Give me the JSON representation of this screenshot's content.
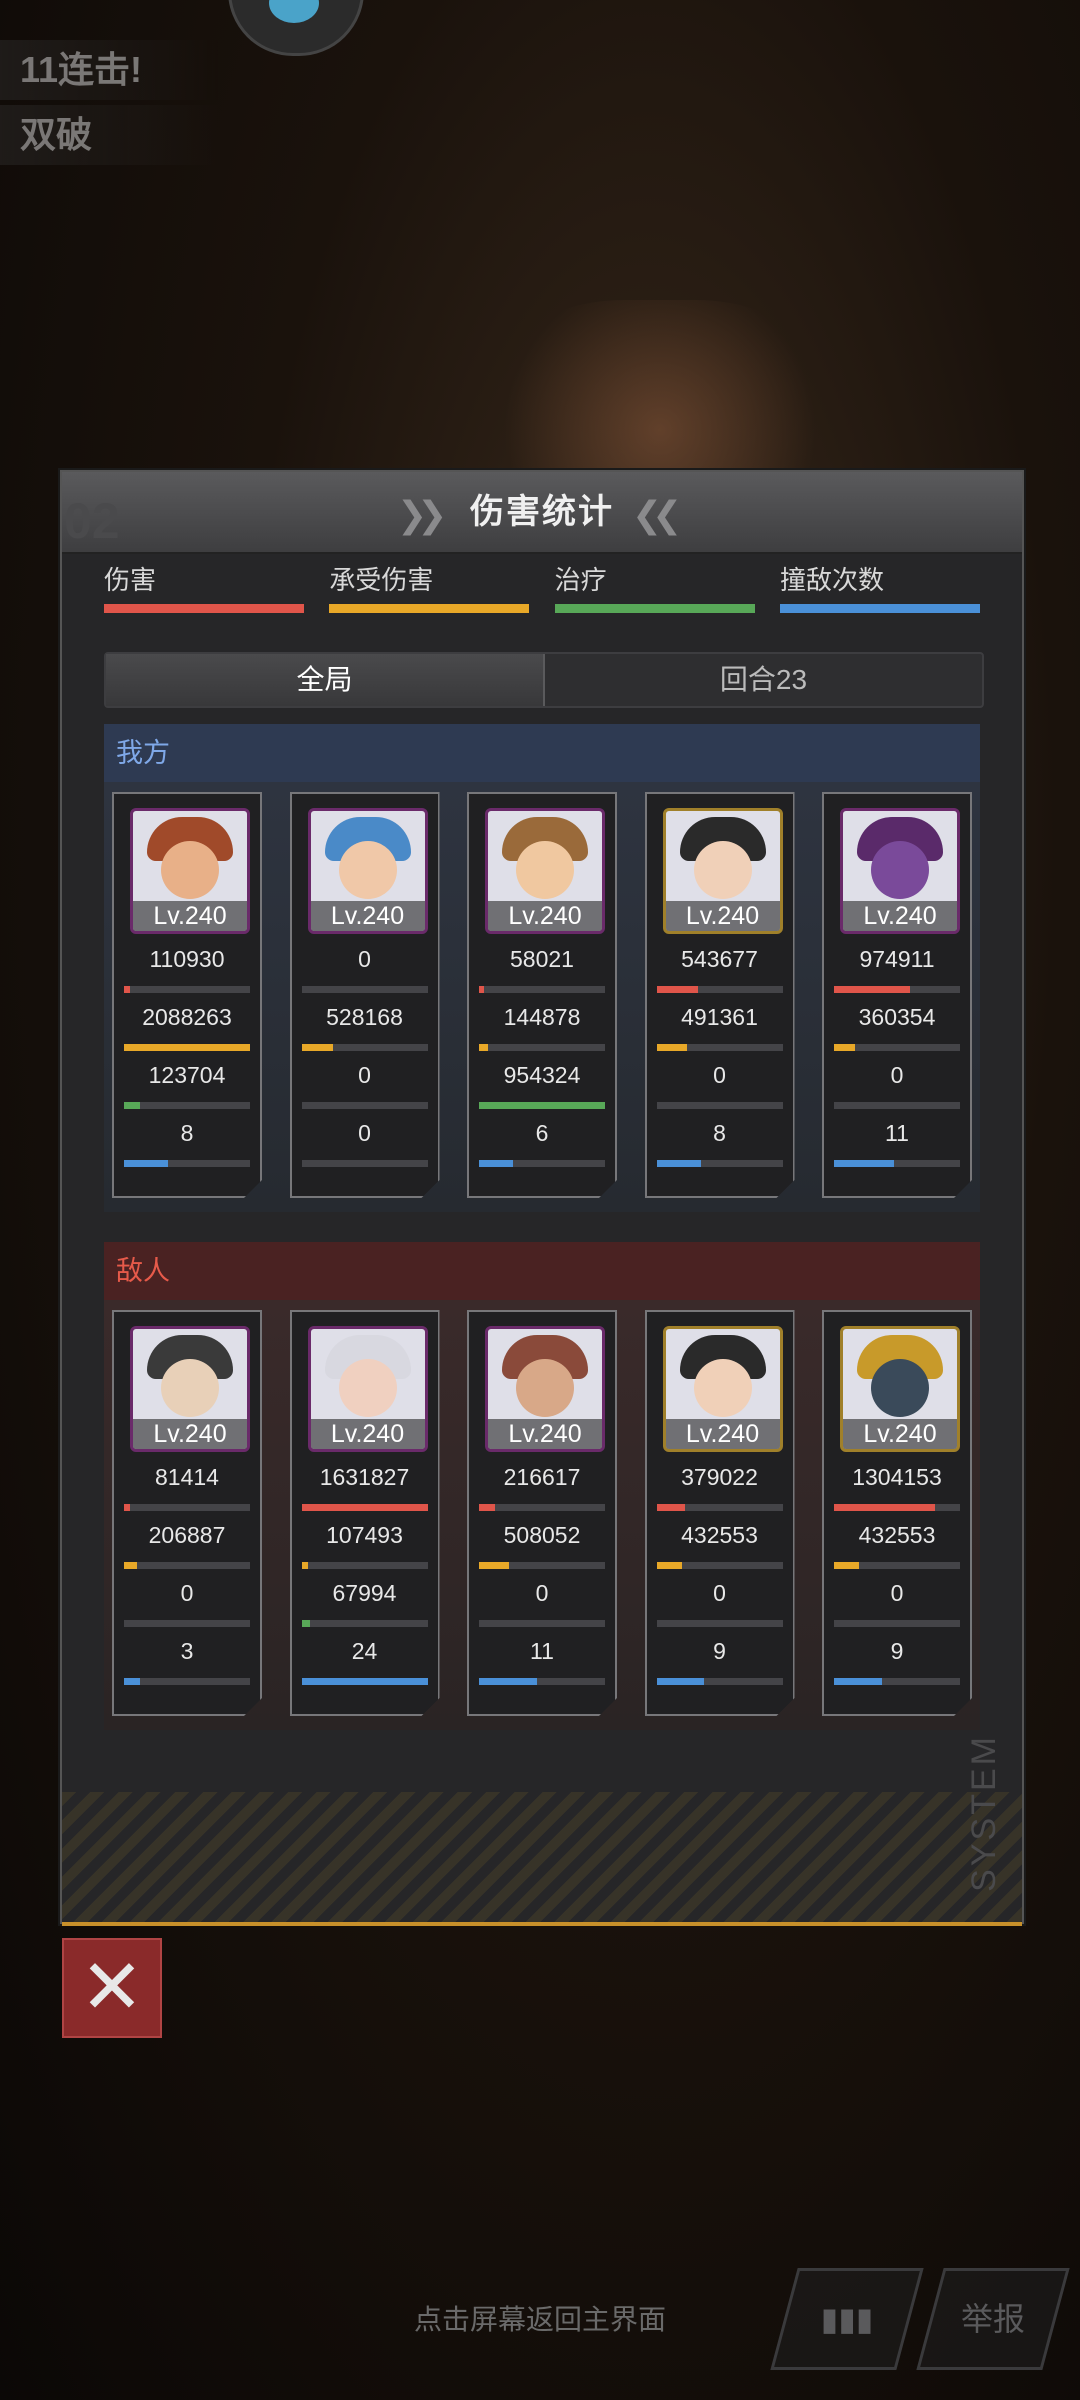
{
  "combo": {
    "line1": "11连击!",
    "line2": "双破"
  },
  "panel": {
    "title": "伤害统计",
    "chevrons_left": "❯❯",
    "chevrons_right": "❮❮",
    "side_deco": "02"
  },
  "legend": [
    {
      "label": "伤害",
      "color": "#e0554a"
    },
    {
      "label": "承受伤害",
      "color": "#e8a828"
    },
    {
      "label": "治疗",
      "color": "#58a858"
    },
    {
      "label": "撞敌次数",
      "color": "#4a90d8"
    }
  ],
  "tabs": [
    {
      "label": "全局",
      "active": true
    },
    {
      "label": "回合23",
      "active": false
    }
  ],
  "ours": {
    "title": "我方",
    "units": [
      {
        "level": "Lv.240",
        "frame": "purple",
        "hair": "#a04a2a",
        "face": "#e8b088",
        "damage": "110930",
        "taken": "2088263",
        "heal": "123704",
        "hits": "8",
        "bars": [
          0.05,
          1.0,
          0.13,
          0.35
        ]
      },
      {
        "level": "Lv.240",
        "frame": "purple",
        "hair": "#4a8ac8",
        "face": "#f0c8a8",
        "damage": "0",
        "taken": "528168",
        "heal": "0",
        "hits": "0",
        "bars": [
          0,
          0.25,
          0,
          0
        ]
      },
      {
        "level": "Lv.240",
        "frame": "purple",
        "hair": "#9a6a3a",
        "face": "#f0c8a0",
        "damage": "58021",
        "taken": "144878",
        "heal": "954324",
        "hits": "6",
        "bars": [
          0.04,
          0.07,
          1.0,
          0.27
        ]
      },
      {
        "level": "Lv.240",
        "frame": "gold",
        "hair": "#2a2a2a",
        "face": "#f0d0b8",
        "damage": "543677",
        "taken": "491361",
        "heal": "0",
        "hits": "8",
        "bars": [
          0.33,
          0.24,
          0,
          0.35
        ]
      },
      {
        "level": "Lv.240",
        "frame": "purple",
        "hair": "#5a2a6a",
        "face": "#7a4a9a",
        "damage": "974911",
        "taken": "360354",
        "heal": "0",
        "hits": "11",
        "bars": [
          0.6,
          0.17,
          0,
          0.48
        ]
      }
    ]
  },
  "enemy": {
    "title": "敌人",
    "units": [
      {
        "level": "Lv.240",
        "frame": "purple",
        "hair": "#3a3a3a",
        "face": "#e8d0b8",
        "damage": "81414",
        "taken": "206887",
        "heal": "0",
        "hits": "3",
        "bars": [
          0.05,
          0.1,
          0,
          0.13
        ]
      },
      {
        "level": "Lv.240",
        "frame": "purple",
        "hair": "#d8d8e0",
        "face": "#f0d0c0",
        "damage": "1631827",
        "taken": "107493",
        "heal": "67994",
        "hits": "24",
        "bars": [
          1.0,
          0.05,
          0.07,
          1.0
        ]
      },
      {
        "level": "Lv.240",
        "frame": "purple",
        "hair": "#8a4a3a",
        "face": "#d8a888",
        "damage": "216617",
        "taken": "508052",
        "heal": "0",
        "hits": "11",
        "bars": [
          0.13,
          0.24,
          0,
          0.46
        ]
      },
      {
        "level": "Lv.240",
        "frame": "gold",
        "hair": "#2a2a2a",
        "face": "#f0d0b8",
        "damage": "379022",
        "taken": "432553",
        "heal": "0",
        "hits": "9",
        "bars": [
          0.23,
          0.2,
          0,
          0.38
        ]
      },
      {
        "level": "Lv.240",
        "frame": "gold",
        "hair": "#c89a2a",
        "face": "#3a4a5a",
        "damage": "1304153",
        "taken": "432553",
        "heal": "0",
        "hits": "9",
        "bars": [
          0.8,
          0.2,
          0,
          0.38
        ]
      }
    ]
  },
  "footer": {
    "system_text": "SYSTEM",
    "close_label": "✕",
    "hint": "点击屏幕返回主界面",
    "stats_icon": "▮▮▮",
    "report_label": "举报"
  }
}
